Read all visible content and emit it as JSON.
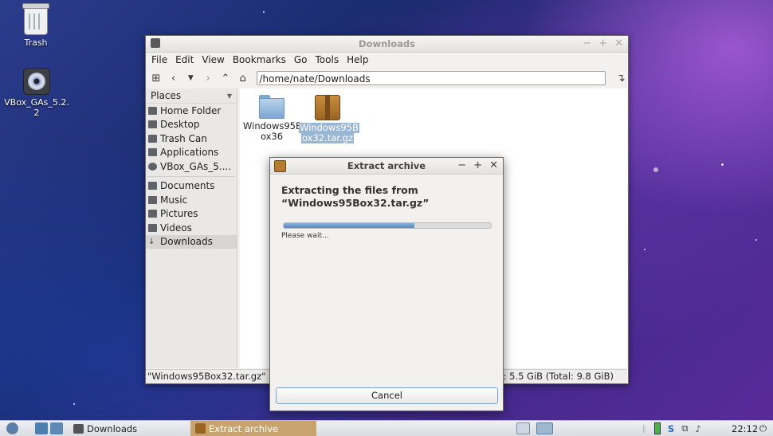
{
  "desktop": {
    "icons": [
      {
        "label": "Trash"
      },
      {
        "label": "VBox_GAs_5.2.2"
      }
    ]
  },
  "file_manager": {
    "title": "Downloads",
    "menu": [
      "File",
      "Edit",
      "View",
      "Bookmarks",
      "Go",
      "Tools",
      "Help"
    ],
    "path": "/home/nate/Downloads",
    "places_label": "Places",
    "places": [
      {
        "label": "Home Folder",
        "icon": "home-icon"
      },
      {
        "label": "Desktop",
        "icon": "desktop-icon"
      },
      {
        "label": "Trash Can",
        "icon": "trash-icon"
      },
      {
        "label": "Applications",
        "icon": "applications-icon"
      },
      {
        "label": "VBox_GAs_5....",
        "icon": "disc-icon"
      }
    ],
    "bookmarks": [
      {
        "label": "Documents",
        "icon": "documents-icon"
      },
      {
        "label": "Music",
        "icon": "music-icon"
      },
      {
        "label": "Pictures",
        "icon": "pictures-icon"
      },
      {
        "label": "Videos",
        "icon": "videos-icon"
      },
      {
        "label": "Downloads",
        "icon": "downloads-icon"
      }
    ],
    "files": [
      {
        "name_line1": "Windows95B",
        "name_line2": "ox36",
        "type": "folder"
      },
      {
        "name_line1": "Windows95B",
        "name_line2": "ox32.tar.gz",
        "type": "archive"
      }
    ],
    "status_left": "\"Windows95Box32.tar.gz\" (4.2",
    "status_right": "pace: 5.5 GiB (Total: 9.8 GiB)"
  },
  "dialog": {
    "title": "Extract archive",
    "heading_line1": "Extracting the files from",
    "heading_line2": "“Windows95Box32.tar.gz”",
    "progress": 0.63,
    "status": "Please wait…",
    "cancel_label": "Cancel"
  },
  "taskbar": {
    "tasks": [
      {
        "label": "Downloads"
      },
      {
        "label": "Extract archive"
      }
    ],
    "clock": "22:12"
  }
}
